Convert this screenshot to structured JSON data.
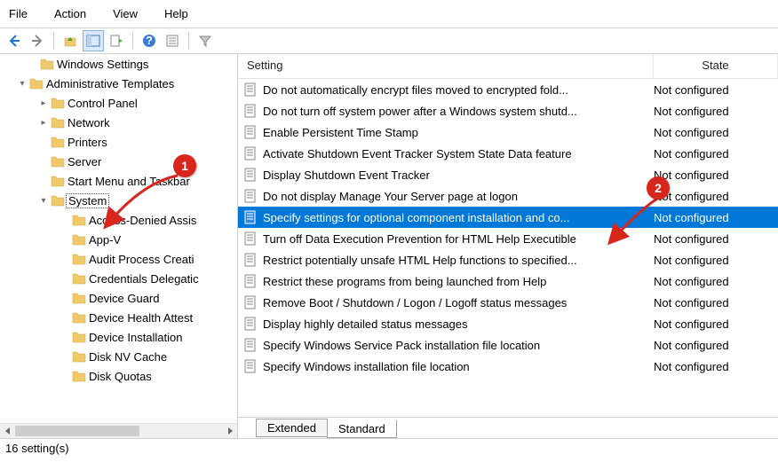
{
  "menu": {
    "file": "File",
    "action": "Action",
    "view": "View",
    "help": "Help"
  },
  "tree": {
    "items": [
      {
        "indent": 30,
        "exp": "",
        "label": "Windows Settings"
      },
      {
        "indent": 18,
        "exp": "▾",
        "label": "Administrative Templates"
      },
      {
        "indent": 42,
        "exp": "▸",
        "label": "Control Panel"
      },
      {
        "indent": 42,
        "exp": "▸",
        "label": "Network"
      },
      {
        "indent": 42,
        "exp": "",
        "label": "Printers"
      },
      {
        "indent": 42,
        "exp": "",
        "label": "Server"
      },
      {
        "indent": 42,
        "exp": "",
        "label": "Start Menu and Taskbar"
      },
      {
        "indent": 42,
        "exp": "▾",
        "label": "System",
        "selected": true
      },
      {
        "indent": 66,
        "exp": "",
        "label": "Access-Denied Assis"
      },
      {
        "indent": 66,
        "exp": "",
        "label": "App-V"
      },
      {
        "indent": 66,
        "exp": "",
        "label": "Audit Process Creati"
      },
      {
        "indent": 66,
        "exp": "",
        "label": "Credentials Delegatic"
      },
      {
        "indent": 66,
        "exp": "",
        "label": "Device Guard"
      },
      {
        "indent": 66,
        "exp": "",
        "label": "Device Health Attest"
      },
      {
        "indent": 66,
        "exp": "",
        "label": "Device Installation"
      },
      {
        "indent": 66,
        "exp": "",
        "label": "Disk NV Cache"
      },
      {
        "indent": 66,
        "exp": "",
        "label": "Disk Quotas"
      }
    ]
  },
  "list": {
    "header_setting": "Setting",
    "header_state": "State",
    "rows": [
      {
        "setting": "Do not automatically encrypt files moved to encrypted fold...",
        "state": "Not configured"
      },
      {
        "setting": "Do not turn off system power after a Windows system shutd...",
        "state": "Not configured"
      },
      {
        "setting": "Enable Persistent Time Stamp",
        "state": "Not configured"
      },
      {
        "setting": "Activate Shutdown Event Tracker System State Data feature",
        "state": "Not configured"
      },
      {
        "setting": "Display Shutdown Event Tracker",
        "state": "Not configured"
      },
      {
        "setting": "Do not display Manage Your Server page at logon",
        "state": "Not configured"
      },
      {
        "setting": "Specify settings for optional component installation and co...",
        "state": "Not configured",
        "selected": true
      },
      {
        "setting": "Turn off Data Execution Prevention for HTML Help Executible",
        "state": "Not configured"
      },
      {
        "setting": "Restrict potentially unsafe HTML Help functions to specified...",
        "state": "Not configured"
      },
      {
        "setting": "Restrict these programs from being launched from Help",
        "state": "Not configured"
      },
      {
        "setting": "Remove Boot / Shutdown / Logon / Logoff status messages",
        "state": "Not configured"
      },
      {
        "setting": "Display highly detailed status messages",
        "state": "Not configured"
      },
      {
        "setting": "Specify Windows Service Pack installation file location",
        "state": "Not configured"
      },
      {
        "setting": "Specify Windows installation file location",
        "state": "Not configured"
      }
    ]
  },
  "tabs": {
    "extended": "Extended",
    "standard": "Standard"
  },
  "status": "16 setting(s)",
  "callouts": {
    "c1": "1",
    "c2": "2"
  }
}
